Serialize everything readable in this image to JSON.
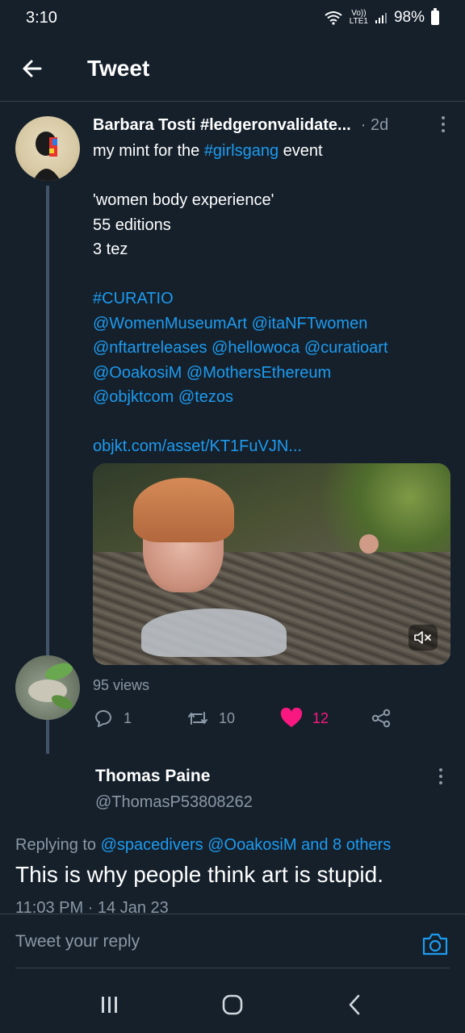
{
  "status": {
    "time": "3:10",
    "signal_top": "Vo))",
    "signal_bottom": "LTE1",
    "battery": "98%"
  },
  "header": {
    "title": "Tweet",
    "back_icon": "arrow-left-icon"
  },
  "tweet": {
    "author": "Barbara Tosti #ledgeronvalidate...",
    "time": "· 2d",
    "body_line1_prefix": "my mint for the ",
    "body_line1_tag": "#girlsgang",
    "body_line1_suffix": " event",
    "title_line": "'women body experience'",
    "editions": "55 editions",
    "price": "3 tez",
    "hashtag": "#CURATIO",
    "mentions": [
      "@WomenMuseumArt @itaNFTwomen",
      "@nftartreleases @hellowoca @curatioart",
      "@OoakosiM @MothersEthereum",
      "@objktcom @tezos"
    ],
    "link": "objkt.com/asset/KT1FuVJN...",
    "views": "95 views",
    "replies": "1",
    "retweets": "10",
    "likes": "12",
    "liked": true,
    "colors": {
      "link": "#1d9bf0",
      "like": "#f91880",
      "muted": "#8b98a5"
    }
  },
  "reply": {
    "author": "Thomas Paine",
    "handle": "@ThomasP53808262",
    "replying_prefix": "Replying to ",
    "replying_to": "@spacedivers @OoakosiM and 8 others",
    "text": "This is why people think art is stupid.",
    "timestamp": "11:03 PM · 14 Jan 23"
  },
  "compose": {
    "placeholder": "Tweet your reply",
    "camera_icon": "camera-icon"
  },
  "navigation": {
    "icons": [
      "recent-apps-icon",
      "home-icon",
      "back-icon"
    ]
  }
}
